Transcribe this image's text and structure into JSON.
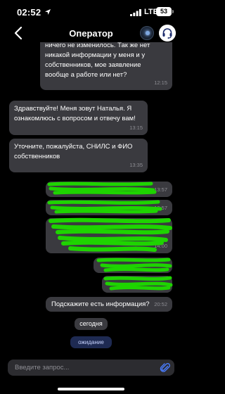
{
  "status_bar": {
    "time": "02:52",
    "network": "LTE",
    "battery": "53"
  },
  "header": {
    "title": "Оператор"
  },
  "messages": [
    {
      "text": "ничего не изменилось. Так же нет\nникакой информации у меня и у\nсобственников, мое заявление\nвообще а работе или нет?",
      "time": "12:15",
      "side": "outgoing"
    },
    {
      "text": "Здравствуйте! Меня зовут Наталья.  Я\nознакомлюсь с вопросом и отвечу вам!",
      "time": "13:15",
      "side": "incoming"
    },
    {
      "text": "Уточните, пожалуйста, СНИЛС и ФИО\nсобственников",
      "time": "13:35",
      "side": "incoming"
    },
    {
      "text": "",
      "time": "13:57",
      "side": "outgoing",
      "redacted": true
    },
    {
      "text": "",
      "time": "13:57",
      "side": "outgoing",
      "redacted": true
    },
    {
      "text": "",
      "time": "14:00",
      "side": "outgoing",
      "redacted": true
    },
    {
      "text": "",
      "time": "",
      "side": "outgoing",
      "redacted": true
    },
    {
      "text": "",
      "time": "",
      "side": "outgoing",
      "redacted": true
    },
    {
      "text": "Подскажите есть информация?",
      "time": "20:52",
      "side": "outgoing"
    }
  ],
  "date_divider": "сегодня",
  "waiting_label": "ожидание",
  "input": {
    "placeholder": "Введите запрос..."
  },
  "icons": {
    "back": "chevron-left-icon",
    "location": "location-arrow-icon",
    "signal": "signal-bars-icon",
    "support": "headset-icon",
    "attach": "paperclip-icon"
  },
  "colors": {
    "background": "#000000",
    "bubble": "#3a3a3f",
    "waiting_pill": "#1e2a52",
    "redaction": "#1ed400"
  }
}
